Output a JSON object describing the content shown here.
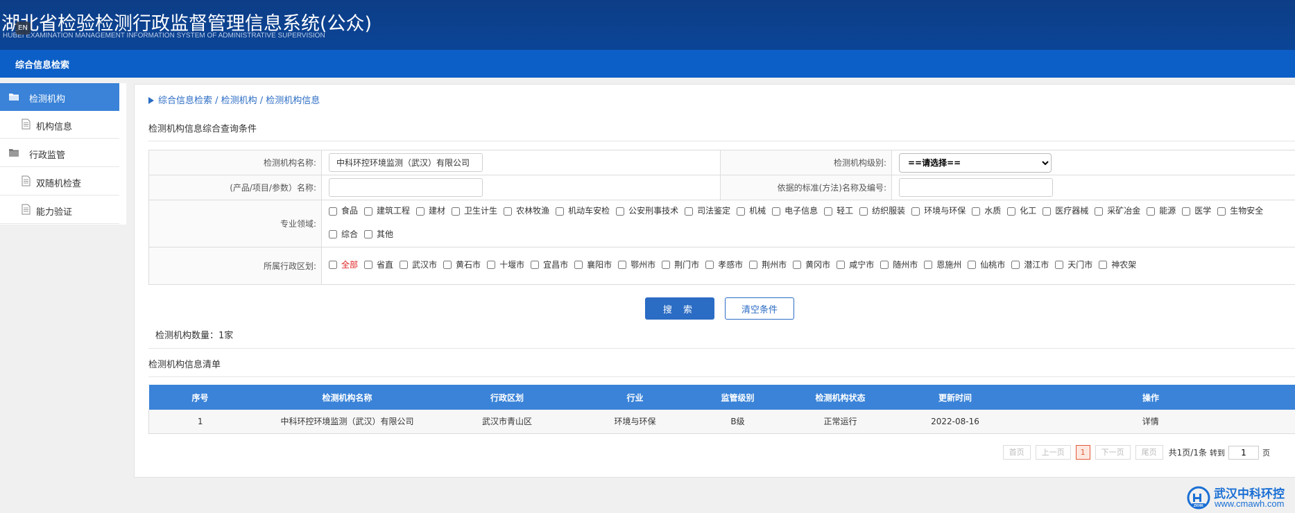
{
  "header": {
    "title": "湖北省检验检测行政监督管理信息系统(公众)",
    "subtitle": "HUBEI EXAMINATION MANAGEMENT INFORMATION SYSTEM OF ADMINISTRATIVE SUPERVISION",
    "lang_badge": "EN"
  },
  "nav": {
    "item": "综合信息检索"
  },
  "sidebar": {
    "items": [
      {
        "label": "检测机构",
        "icon": "folder-open-icon",
        "active": true
      },
      {
        "label": "机构信息",
        "icon": "document-icon"
      },
      {
        "label": "行政监管",
        "icon": "folder-icon"
      },
      {
        "label": "双随机检查",
        "icon": "document-icon"
      },
      {
        "label": "能力验证",
        "icon": "document-icon"
      }
    ]
  },
  "breadcrumb": "综合信息检索 / 检测机构 / 检测机构信息",
  "query": {
    "section_title": "检测机构信息综合查询条件",
    "name_label": "检测机构名称:",
    "name_value": "中科环控环境监测（武汉）有限公司",
    "level_label": "检测机构级别:",
    "level_value": "==请选择==",
    "product_label": "(产品/项目/参数）名称:",
    "product_value": "",
    "standard_label": "依据的标准(方法)名称及编号:",
    "standard_value": "",
    "field_label": "专业领域:",
    "fields": [
      "食品",
      "建筑工程",
      "建材",
      "卫生计生",
      "农林牧渔",
      "机动车安检",
      "公安刑事技术",
      "司法鉴定",
      "机械",
      "电子信息",
      "轻工",
      "纺织服装",
      "环境与环保",
      "水质",
      "化工",
      "医疗器械",
      "采矿冶金",
      "能源",
      "医学",
      "生物安全",
      "综合",
      "其他"
    ],
    "region_label": "所属行政区划:",
    "regions": [
      "全部",
      "省直",
      "武汉市",
      "黄石市",
      "十堰市",
      "宜昌市",
      "襄阳市",
      "鄂州市",
      "荆门市",
      "孝感市",
      "荆州市",
      "黄冈市",
      "咸宁市",
      "随州市",
      "恩施州",
      "仙桃市",
      "潜江市",
      "天门市",
      "神农架"
    ],
    "search_button": "搜 索",
    "clear_button": "清空条件"
  },
  "count_text": "检测机构数量：1家",
  "results": {
    "section_title": "检测机构信息清单",
    "columns": [
      "序号",
      "检测机构名称",
      "行政区划",
      "行业",
      "监管级别",
      "检测机构状态",
      "更新时间",
      "操作"
    ],
    "rows": [
      [
        "1",
        "中科环控环境监测（武汉）有限公司",
        "武汉市青山区",
        "环境与环保",
        "B级",
        "正常运行",
        "2022-08-16",
        "详情"
      ]
    ]
  },
  "pager": {
    "first": "首页",
    "prev": "上一页",
    "current": "1",
    "next": "下一页",
    "last": "尾页",
    "info": "共1页/1条",
    "goto_label": "转到",
    "goto_value": "1",
    "page_suffix": "页"
  },
  "watermark": {
    "name": "武汉中科环控",
    "url": "www.cmawh.com",
    "logo_text": "ZKHK"
  },
  "colors": {
    "header_bg": "#0d3d86",
    "nav_bg": "#0c5fc7",
    "accent": "#2b6cc4",
    "active_sidebar": "#3a83d8",
    "table_header": "#3a83d8",
    "current_page": "#e05a3a"
  }
}
